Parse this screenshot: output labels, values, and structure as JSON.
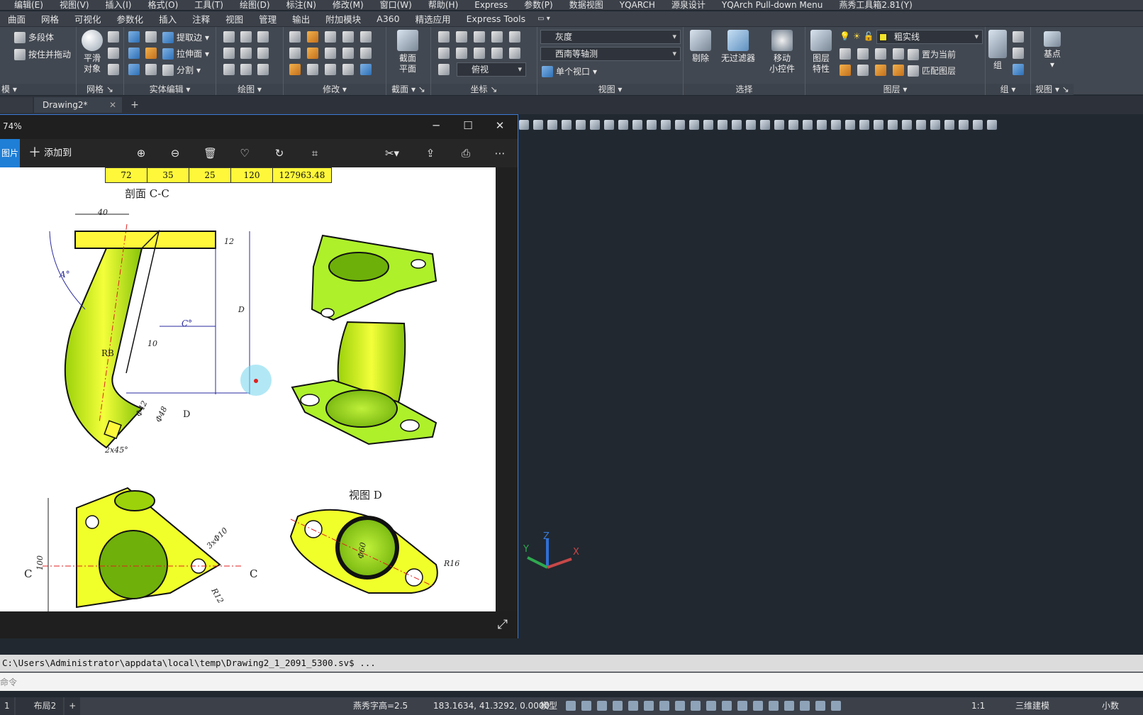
{
  "menu": [
    "编辑(E)",
    "视图(V)",
    "插入(I)",
    "格式(O)",
    "工具(T)",
    "绘图(D)",
    "标注(N)",
    "修改(M)",
    "窗口(W)",
    "帮助(H)",
    "Express",
    "参数(P)",
    "数据视图",
    "YQARCH",
    "源泉设计",
    "YQArch Pull-down Menu",
    "燕秀工具箱2.81(Y)"
  ],
  "ribbon_tabs": [
    "曲面",
    "网格",
    "可视化",
    "参数化",
    "插入",
    "注释",
    "视图",
    "管理",
    "输出",
    "附加模块",
    "A360",
    "精选应用",
    "Express Tools"
  ],
  "ribbon": {
    "modeling": {
      "item1": "多段体",
      "item2": "按住并拖动",
      "label": "模"
    },
    "mesh": {
      "smooth_line1": "平滑",
      "smooth_line2": "对象",
      "label": "网格"
    },
    "solid_edit": {
      "item1": "提取边",
      "item2": "拉伸面",
      "item3": "分割",
      "label": "实体编辑"
    },
    "draw": {
      "label": "绘图"
    },
    "modify": {
      "label": "修改"
    },
    "section": {
      "line1": "截面",
      "line2": "平面",
      "label": "截面"
    },
    "coords": {
      "label": "坐标",
      "view_combo": "俯视"
    },
    "view": {
      "style_combo": "灰度",
      "view_combo": "西南等轴测",
      "viewport": "单个视口",
      "label": "视图"
    },
    "selection": {
      "cull": "剔除",
      "no_filter": "无过滤器",
      "gizmo_line1": "移动",
      "gizmo_line2": "小控件",
      "label": "选择"
    },
    "layers": {
      "props_line1": "图层",
      "props_line2": "特性",
      "layer_combo": "粗实线",
      "set_current": "置为当前",
      "match_layer": "匹配图层",
      "label": "图层"
    },
    "group": {
      "btn": "组",
      "label": "组"
    },
    "view2": {
      "base_point": "基点",
      "label": "视图"
    }
  },
  "doc_tab": "Drawing2*",
  "viewer": {
    "zoom": "74%",
    "tab": "图片",
    "add_to": "添加到",
    "table": [
      "72",
      "35",
      "25",
      "120",
      "127963.48"
    ],
    "labels": {
      "section": "剖面 C-C",
      "view_d": "视图 D"
    },
    "dims": [
      "40",
      "12",
      "D",
      "A°",
      "C°",
      "RB",
      "10",
      "Φ42",
      "Φ48",
      "D",
      "2x45°",
      "100",
      "3xΦ10",
      "R12",
      "Φ60",
      "R16",
      "C",
      "C"
    ]
  },
  "command_history": "C:\\Users\\Administrator\\appdata\\local\\temp\\Drawing2_1_2091_5300.sv$ ...",
  "command_prompt": "命令",
  "status": {
    "layout_tabs": [
      "1",
      "布局2"
    ],
    "text_height": "燕秀字高=2.5",
    "coords": "183.1634, 41.3292, 0.0000",
    "model": "模型",
    "scale": "1:1",
    "workspace": "三维建模",
    "units": "小数"
  },
  "ucs_labels": [
    "Y",
    "Z",
    "X"
  ]
}
